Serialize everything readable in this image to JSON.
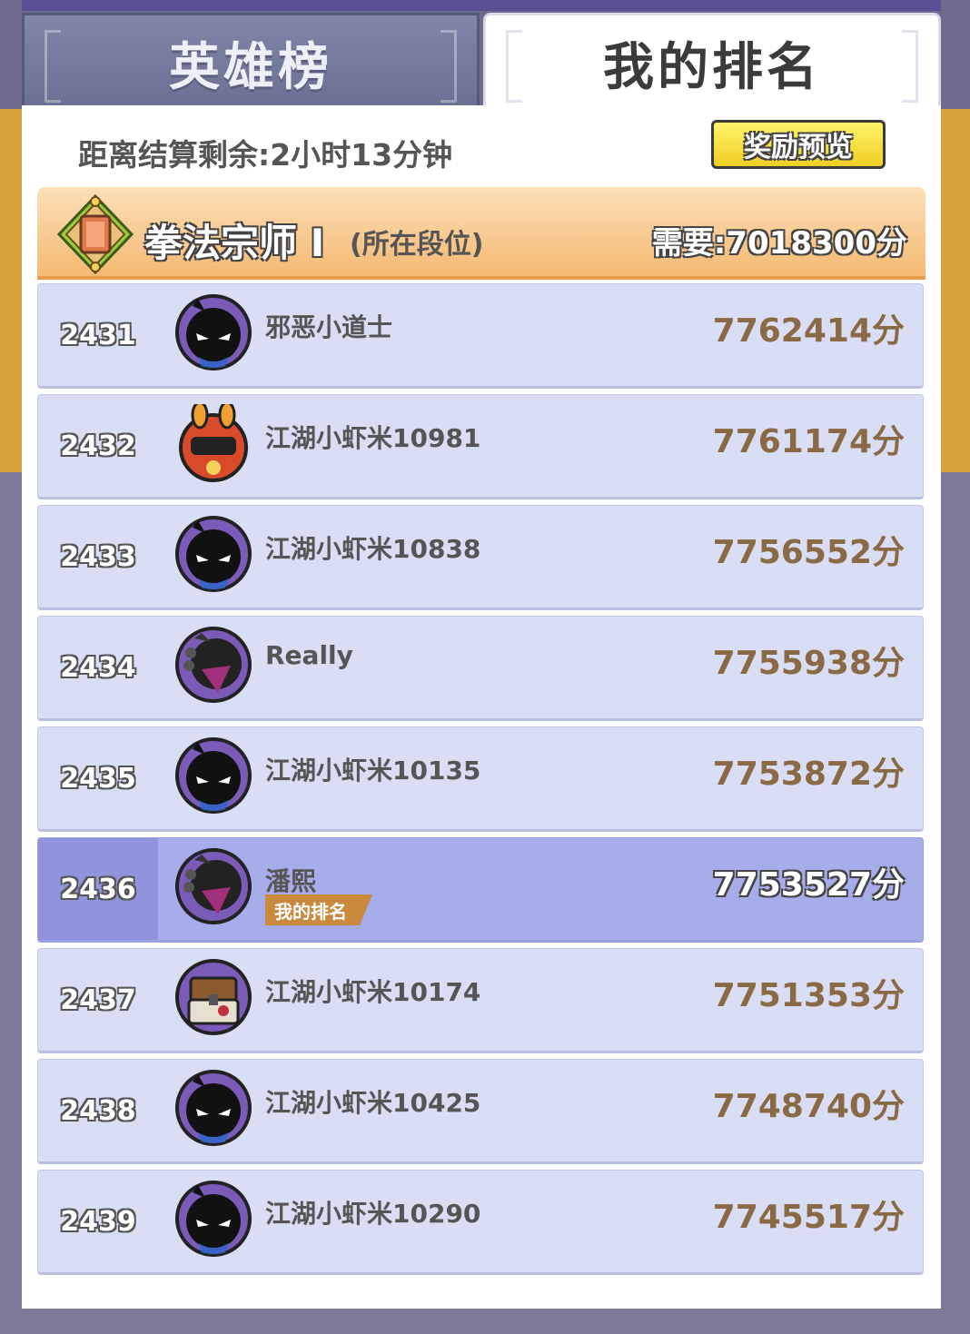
{
  "tabs": [
    {
      "label": "英雄榜",
      "active": false
    },
    {
      "label": "我的排名",
      "active": true
    }
  ],
  "timer_text": "距离结算剩余:2小时13分钟",
  "reward_button": "奖励预览",
  "tier": {
    "name": "拳法宗师 I",
    "note": "(所在段位)",
    "need": "需要:7018300分"
  },
  "my_rank_badge": "我的排名",
  "rows": [
    {
      "rank": "2431",
      "name": "邪恶小道士",
      "score": "7762414分",
      "avatar": "shadow-ninja-blue-icon",
      "me": false
    },
    {
      "rank": "2432",
      "name": "江湖小虾米10981",
      "score": "7761174分",
      "avatar": "red-bunny-warrior-icon",
      "me": false
    },
    {
      "rank": "2433",
      "name": "江湖小虾米10838",
      "score": "7756552分",
      "avatar": "shadow-ninja-blue-icon",
      "me": false
    },
    {
      "rank": "2434",
      "name": "Really",
      "score": "7755938分",
      "avatar": "masked-assassin-icon",
      "me": false
    },
    {
      "rank": "2435",
      "name": "江湖小虾米10135",
      "score": "7753872分",
      "avatar": "shadow-ninja-blue-icon",
      "me": false
    },
    {
      "rank": "2436",
      "name": "潘熙",
      "score": "7753527分",
      "avatar": "masked-assassin-icon",
      "me": true
    },
    {
      "rank": "2437",
      "name": "江湖小虾米10174",
      "score": "7751353分",
      "avatar": "treasure-chest-icon",
      "me": false
    },
    {
      "rank": "2438",
      "name": "江湖小虾米10425",
      "score": "7748740分",
      "avatar": "shadow-ninja-blue-icon",
      "me": false
    },
    {
      "rank": "2439",
      "name": "江湖小虾米10290",
      "score": "7745517分",
      "avatar": "shadow-ninja-blue-icon",
      "me": false
    }
  ],
  "colors": {
    "row_bg": "#d9def5",
    "me_row_bg": "#a7acea",
    "score": "#8a6a45",
    "tier_gradient_top": "#fbe0b8",
    "tier_gradient_bottom": "#f5b972",
    "button_yellow": "#f0cf24"
  }
}
